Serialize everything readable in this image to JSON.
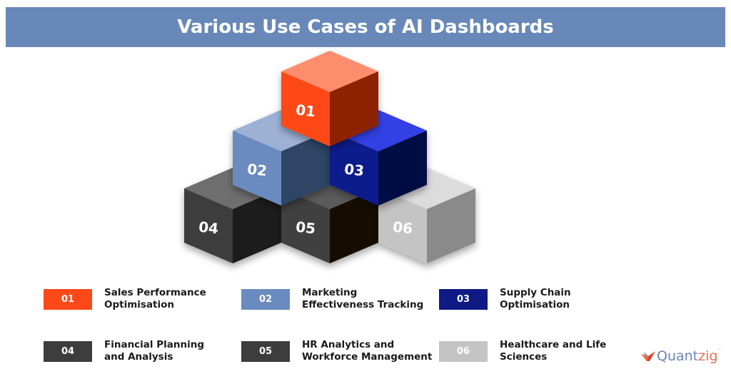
{
  "title": "Various Use Cases of AI Dashboards",
  "cubes": [
    {
      "id": "01",
      "top": "#fe8d6e",
      "left": "#fe4818",
      "right": "#8c2201"
    },
    {
      "id": "02",
      "top": "#9cb1d4",
      "left": "#6a8bc0",
      "right": "#2f4466"
    },
    {
      "id": "03",
      "top": "#3340e6",
      "left": "#111c8c",
      "right": "#040a45"
    },
    {
      "id": "04",
      "top": "#6e6e6e",
      "left": "#3c3c3c",
      "right": "#1f1f1f"
    },
    {
      "id": "05",
      "top": "#5a5a5a",
      "left": "#404040",
      "right": "#150c06"
    },
    {
      "id": "06",
      "top": "#dcdcdc",
      "left": "#c4c4c4",
      "right": "#8a8a8a"
    }
  ],
  "legend": [
    {
      "num": "01",
      "color": "#fe4818",
      "line1": "Sales Performance",
      "line2": "Optimisation"
    },
    {
      "num": "02",
      "color": "#6a8bc0",
      "line1": "Marketing",
      "line2": "Effectiveness Tracking"
    },
    {
      "num": "03",
      "color": "#0f1a84",
      "line1": "Supply Chain",
      "line2": "Optimisation"
    },
    {
      "num": "04",
      "color": "#3d3d3d",
      "line1": "Financial Planning",
      "line2": "and Analysis"
    },
    {
      "num": "05",
      "color": "#3d3d3d",
      "line1": "HR Analytics and",
      "line2": "Workforce Management"
    },
    {
      "num": "06",
      "color": "#c4c4c4",
      "line1": "Healthcare and Life",
      "line2": "Sciences"
    }
  ],
  "logo": {
    "part1": "Quant",
    "part2": "zig",
    "tm": "™"
  }
}
